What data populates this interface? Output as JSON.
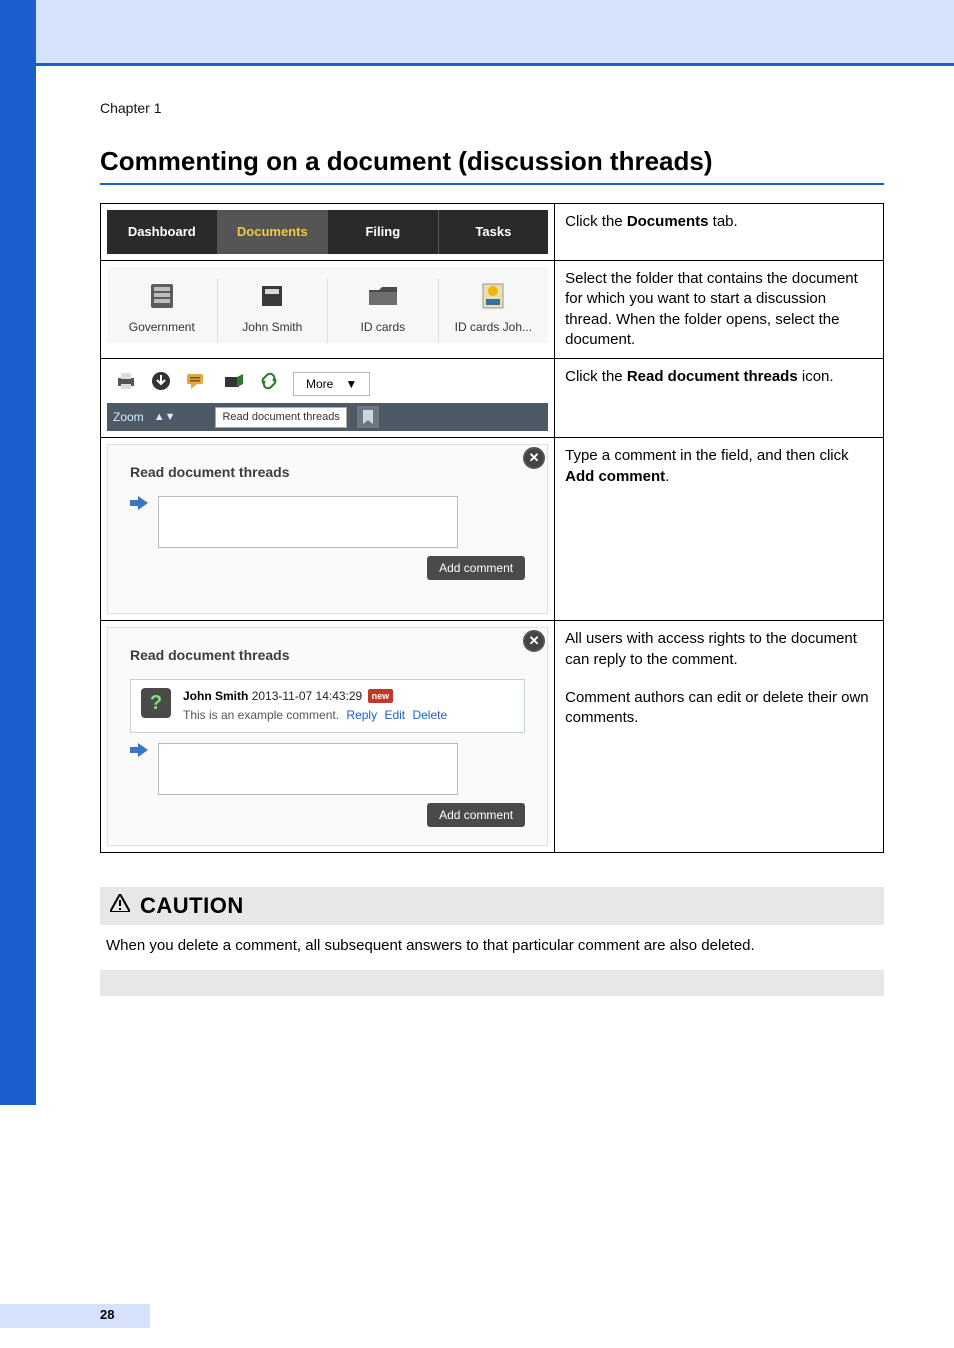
{
  "page": {
    "chapter": "Chapter 1",
    "heading": "Commenting on a document (discussion threads)",
    "number": "28"
  },
  "steps": {
    "s1": {
      "tabs": [
        "Dashboard",
        "Documents",
        "Filing",
        "Tasks"
      ],
      "desc_prefix": "Click the ",
      "desc_bold": "Documents",
      "desc_suffix": " tab."
    },
    "s2": {
      "crumbs": [
        "Government",
        "John Smith",
        "ID cards",
        "ID cards Joh..."
      ],
      "desc": "Select the folder that contains the document for which you want to start a discussion thread. When the folder opens, select the document."
    },
    "s3": {
      "more": "More",
      "zoom": "Zoom",
      "tooltip": "Read document threads",
      "desc_prefix": "Click the ",
      "desc_bold": "Read document threads",
      "desc_suffix": " icon."
    },
    "s4": {
      "title": "Read document threads",
      "add": "Add comment",
      "desc_prefix": "Type a comment in the field, and then click ",
      "desc_bold": "Add comment",
      "desc_suffix": "."
    },
    "s5": {
      "title": "Read document threads",
      "author": "John Smith",
      "timestamp": "2013-11-07 14:43:29",
      "new": "new",
      "body": "This is an example comment.",
      "reply": "Reply",
      "edit": "Edit",
      "delete": "Delete",
      "add": "Add comment",
      "desc1": "All users with access rights to the document can reply to the comment.",
      "desc2": "Comment authors can edit or delete their own comments."
    }
  },
  "caution": {
    "label": "CAUTION",
    "body": "When you delete a comment, all subsequent answers to that particular comment are also deleted."
  }
}
